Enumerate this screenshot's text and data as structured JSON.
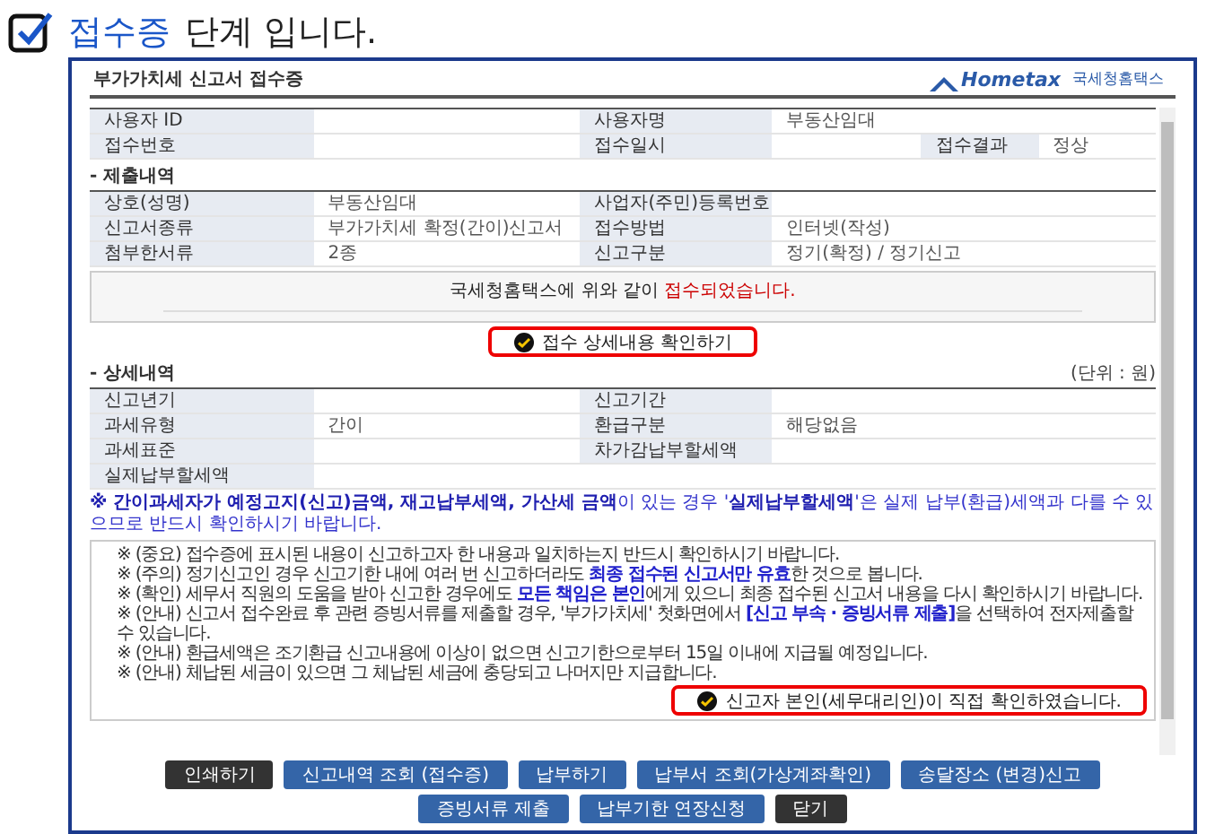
{
  "heading": {
    "highlight": "접수증",
    "rest": "단계 입니다.",
    "checked": true
  },
  "dialog": {
    "title": "부가가치세 신고서 접수증",
    "logo": {
      "brand": "Hometax",
      "org": "국세청홈택스"
    }
  },
  "user_table": [
    [
      {
        "kind": "label",
        "text": "사용자 ID"
      },
      {
        "kind": "value"
      },
      {
        "kind": "label",
        "text": "사용자명"
      },
      {
        "kind": "value",
        "text": "부동산임대"
      }
    ],
    [
      {
        "kind": "label",
        "text": "접수번호"
      },
      {
        "kind": "value"
      },
      {
        "kind": "label",
        "text": "접수일시"
      },
      {
        "kind": "value"
      },
      {
        "kind": "label",
        "text": "접수결과"
      },
      {
        "kind": "value",
        "text": "정상"
      }
    ]
  ],
  "submission": {
    "title": "- 제출내역",
    "rows": [
      [
        {
          "kind": "label",
          "text": "상호(성명)"
        },
        {
          "kind": "value",
          "text": "부동산임대"
        },
        {
          "kind": "label",
          "text": "사업자(주민)등록번호"
        },
        {
          "kind": "value"
        }
      ],
      [
        {
          "kind": "label",
          "text": "신고서종류"
        },
        {
          "kind": "value",
          "text": "부가가치세 확정(간이)신고서"
        },
        {
          "kind": "label",
          "text": "접수방법"
        },
        {
          "kind": "value",
          "text": "인터넷(작성)"
        }
      ],
      [
        {
          "kind": "label",
          "text": "첨부한서류"
        },
        {
          "kind": "value",
          "text": "2종"
        },
        {
          "kind": "label",
          "text": "신고구분"
        },
        {
          "kind": "value",
          "text": "정기(확정) / 정기신고"
        }
      ]
    ]
  },
  "message": [
    {
      "kind": "normal",
      "text": "국세청홈택스에 위와 같이 "
    },
    {
      "kind": "emphasis",
      "text": "접수되었습니다."
    }
  ],
  "detail_button": {
    "label": "접수 상세내용 확인하기",
    "highlighted": true
  },
  "details": {
    "title": "- 상세내역",
    "unit": "(단위 : 원)",
    "rows": [
      [
        {
          "kind": "label",
          "text": "신고년기"
        },
        {
          "kind": "value"
        },
        {
          "kind": "label",
          "text": "신고기간"
        },
        {
          "kind": "value"
        }
      ],
      [
        {
          "kind": "label",
          "text": "과세유형"
        },
        {
          "kind": "value",
          "text": "간이"
        },
        {
          "kind": "label",
          "text": "환급구분"
        },
        {
          "kind": "value",
          "text": "해당없음"
        }
      ],
      [
        {
          "kind": "label",
          "text": "과세표준"
        },
        {
          "kind": "value"
        },
        {
          "kind": "label",
          "text": "차가감납부할세액"
        },
        {
          "kind": "value"
        }
      ],
      [
        {
          "kind": "label",
          "text": "실제납부할세액"
        },
        {
          "kind": "value"
        }
      ]
    ]
  },
  "note": "**※ 간이과세자가 예정고지(신고)금액, 재고납부세액, 가산세 금액**이 있는 경우 '**실제납부할세액**'은 실제 납부(환급)세액과 다를 수 있으므로 반드시 확인하시기 바랍니다.",
  "notices": [
    "※ (중요) 접수증에 표시된 내용이 신고하고자 한 내용과 일치하는지 반드시 확인하시기 바랍니다.",
    "※ (주의) 정기신고인 경우 신고기한 내에 여러 번 신고하더라도 **최종 접수된 신고서만 유효**한 것으로 봅니다.",
    "※ (확인) 세무서 직원의 도움을 받아 신고한 경우에도 **모든 책임은 본인**에게 있으니 최종 접수된 신고서 내용을 다시 확인하시기 바랍니다.",
    "※ (안내) 신고서 접수완료 후 관련 증빙서류를 제출할 경우, '부가가치세' 첫화면에서 **[신고 부속 · 증빙서류 제출]**을 선택하여 전자제출할 수 있습니다.",
    "※ (안내) 환급세액은 조기환급 신고내용에 이상이 없으면 신고기한으로부터 15일 이내에 지급될 예정입니다.",
    "※ (안내) 체납된 세금이 있으면 그 체납된 세금에 충당되고 나머지만 지급합니다."
  ],
  "confirm": {
    "label": "신고자 본인(세무대리인)이 직접 확인하였습니다.",
    "highlighted": true
  },
  "buttons": [
    [
      {
        "label": "인쇄하기",
        "kind": "dark"
      },
      {
        "label": "신고내역 조회 (접수증)",
        "kind": "blue"
      },
      {
        "label": "납부하기",
        "kind": "blue"
      },
      {
        "label": "납부서 조회(가상계좌확인)",
        "kind": "blue"
      },
      {
        "label": "송달장소 (변경)신고",
        "kind": "blue"
      }
    ],
    [
      {
        "label": "증빙서류 제출",
        "kind": "blue"
      },
      {
        "label": "납부기한 연장신청",
        "kind": "blue"
      },
      {
        "label": "닫기",
        "kind": "dark"
      }
    ]
  ]
}
